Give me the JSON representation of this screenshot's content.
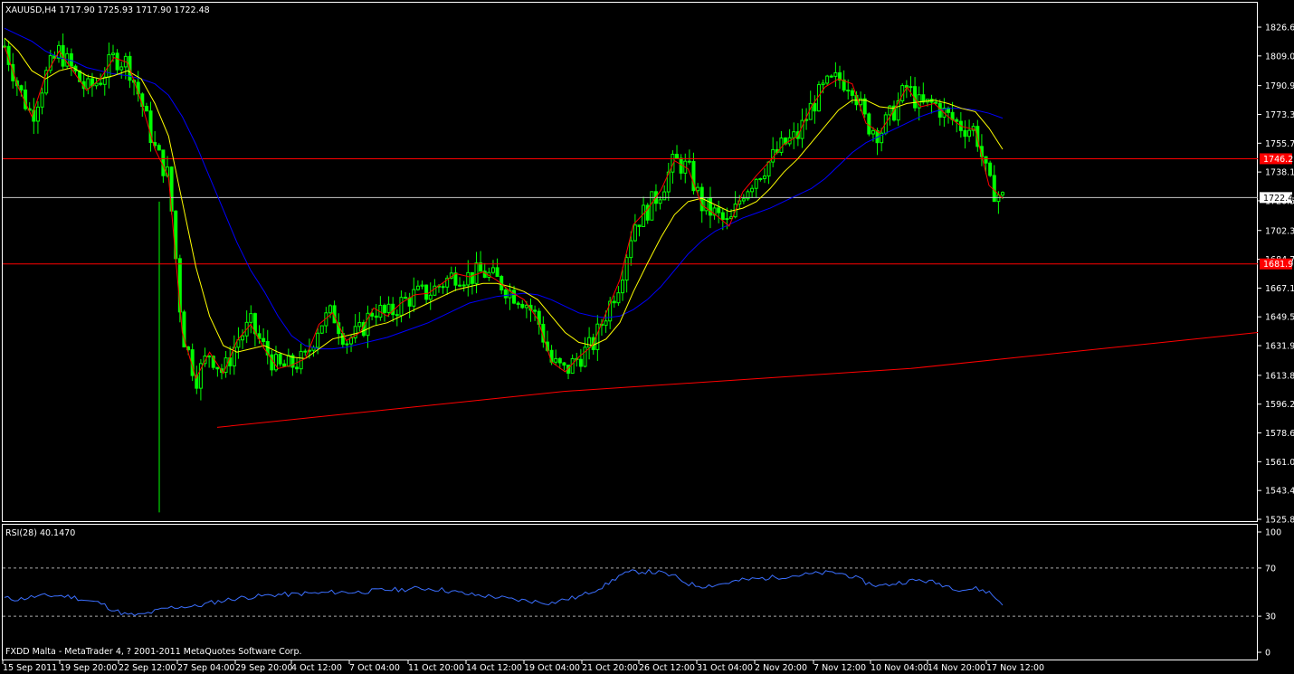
{
  "main_chart": {
    "header": "XAUUSD,H4  1717.90 1725.93 1717.90 1722.48",
    "bid_label": "1722.48",
    "levels": [
      {
        "label": "1746.2",
        "value": 1746.2,
        "color": "#ff0000"
      },
      {
        "label": "1681.9",
        "value": 1681.9,
        "color": "#ff0000"
      }
    ],
    "bid_value": 1722.48,
    "bid_line_color": "#c8c8c8"
  },
  "rsi_panel": {
    "header": "RSI(28) 40.1470",
    "y_ticks": [
      "100",
      "70",
      "30",
      "0"
    ],
    "levels": [
      70,
      30
    ],
    "line_color": "#3b6fff"
  },
  "copyright": "FXDD Malta - MetaTrader 4, ? 2001-2011 MetaQuotes Software Corp.",
  "colors": {
    "background": "#000000",
    "frame": "#ffffff",
    "bull_candle": "#00ff00",
    "ma_fast": "#ff0000",
    "ma_mid": "#ffff00",
    "ma_slow": "#0000ff",
    "trendline": "#ff0000"
  },
  "chart_data": {
    "type": "line",
    "title": "XAUUSD,H4",
    "x_ticks": [
      "15 Sep 2011",
      "19 Sep 20:00",
      "22 Sep 12:00",
      "27 Sep 04:00",
      "29 Sep 20:00",
      "4 Oct 12:00",
      "7 Oct 04:00",
      "11 Oct 20:00",
      "14 Oct 12:00",
      "19 Oct 04:00",
      "21 Oct 20:00",
      "26 Oct 12:00",
      "31 Oct 04:00",
      "2 Nov 20:00",
      "7 Nov 12:00",
      "10 Nov 04:00",
      "14 Nov 20:00",
      "17 Nov 12:00"
    ],
    "y_ticks": [
      "1826.65",
      "1809.05",
      "1790.90",
      "1773.30",
      "1755.70",
      "1738.10",
      "1720.50",
      "1702.35",
      "1684.75",
      "1667.15",
      "1649.55",
      "1631.95",
      "1613.80",
      "1596.20",
      "1578.60",
      "1561.00",
      "1543.40",
      "1525.80"
    ],
    "ylim": [
      1525.8,
      1835
    ],
    "series": [
      {
        "values": [
          1815,
          1790,
          1772,
          1797,
          1812,
          1800,
          1788,
          1795,
          1808,
          1805,
          1781,
          1752,
          1735,
          1640,
          1612,
          1628,
          1615,
          1635,
          1645,
          1630,
          1618,
          1620,
          1624,
          1645,
          1652,
          1635,
          1640,
          1655,
          1650,
          1658,
          1663,
          1664,
          1670,
          1676,
          1674,
          1677,
          1672,
          1665,
          1660,
          1648,
          1622,
          1616,
          1625,
          1632,
          1652,
          1672,
          1706,
          1715,
          1727,
          1745,
          1740,
          1718,
          1712,
          1705,
          1726,
          1736,
          1745,
          1755,
          1760,
          1778,
          1790,
          1795,
          1792,
          1768,
          1762,
          1775,
          1790,
          1778,
          1780,
          1772,
          1766,
          1764,
          1730,
          1722
        ]
      },
      {
        "values": [
          1820,
          1812,
          1800,
          1795,
          1800,
          1802,
          1797,
          1795,
          1797,
          1800,
          1795,
          1780,
          1760,
          1720,
          1680,
          1650,
          1632,
          1628,
          1630,
          1632,
          1628,
          1625,
          1624,
          1630,
          1636,
          1638,
          1640,
          1644,
          1646,
          1650,
          1654,
          1658,
          1662,
          1666,
          1668,
          1670,
          1670,
          1668,
          1665,
          1660,
          1650,
          1640,
          1634,
          1632,
          1636,
          1646,
          1665,
          1682,
          1698,
          1712,
          1720,
          1722,
          1718,
          1714,
          1716,
          1720,
          1728,
          1738,
          1746,
          1756,
          1766,
          1776,
          1782,
          1782,
          1778,
          1777,
          1780,
          1781,
          1782,
          1780,
          1777,
          1775,
          1765,
          1752
        ]
      },
      {
        "values": [
          1826,
          1822,
          1818,
          1812,
          1808,
          1806,
          1802,
          1800,
          1798,
          1797,
          1795,
          1792,
          1785,
          1772,
          1755,
          1735,
          1715,
          1695,
          1678,
          1665,
          1650,
          1638,
          1632,
          1630,
          1630,
          1631,
          1633,
          1635,
          1637,
          1640,
          1643,
          1646,
          1650,
          1654,
          1658,
          1660,
          1662,
          1663,
          1664,
          1663,
          1660,
          1656,
          1652,
          1650,
          1649,
          1650,
          1654,
          1660,
          1668,
          1678,
          1688,
          1696,
          1702,
          1706,
          1710,
          1713,
          1716,
          1720,
          1724,
          1728,
          1734,
          1742,
          1750,
          1756,
          1760,
          1764,
          1768,
          1772,
          1775,
          1777,
          1777,
          1776,
          1774,
          1771
        ]
      },
      {
        "values": [
          1582,
          1604,
          1618,
          1640
        ]
      },
      {
        "values": [
          45,
          44,
          46,
          47,
          47,
          46,
          43,
          41,
          35,
          31,
          31,
          34,
          37,
          38,
          38,
          41,
          43,
          45,
          46,
          47,
          48,
          48,
          49,
          49,
          50,
          50,
          50,
          51,
          52,
          52,
          53,
          53,
          52,
          50,
          48,
          47,
          46,
          44,
          43,
          42,
          41,
          44,
          46,
          51,
          56,
          64,
          67,
          67,
          66,
          63,
          57,
          55,
          56,
          58,
          60,
          61,
          62,
          63,
          64,
          65,
          66,
          66,
          63,
          58,
          55,
          57,
          59,
          60,
          58,
          55,
          52,
          53,
          50,
          40
        ]
      }
    ]
  }
}
